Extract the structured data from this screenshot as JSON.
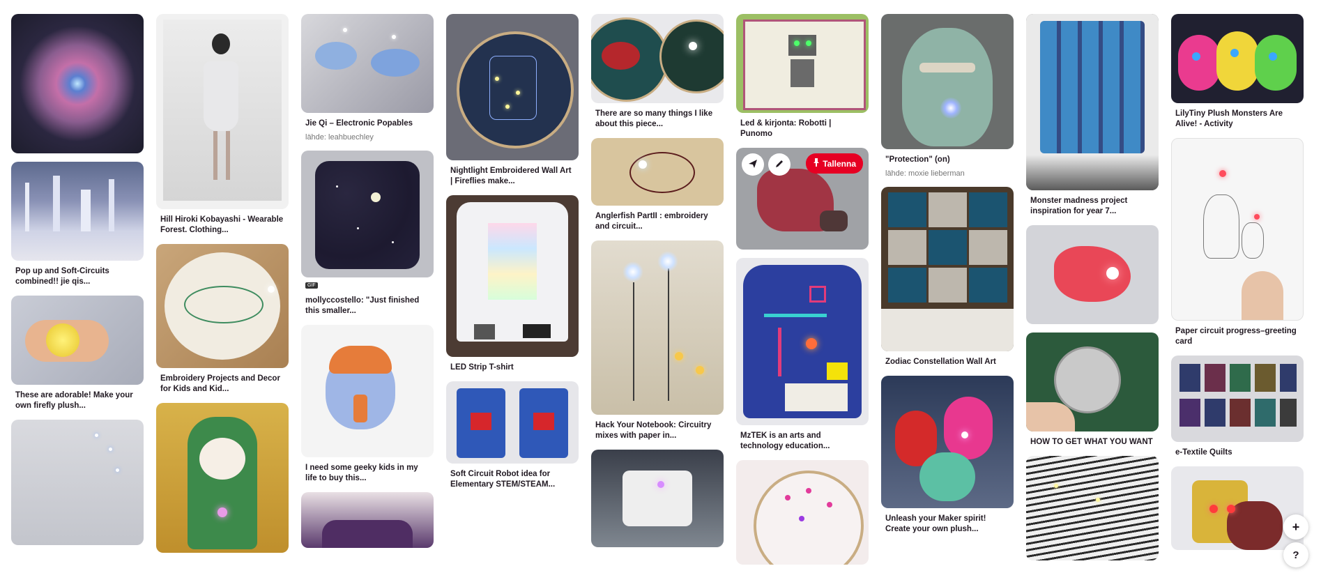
{
  "pins": {
    "c1": [
      {
        "caption": ""
      },
      {
        "caption": "Pop up and Soft-Circuits combined!! jie qis..."
      },
      {
        "caption": "These are adorable! Make your own firefly plush..."
      },
      {
        "caption": ""
      }
    ],
    "c2": [
      {
        "caption": "Hill Hiroki Kobayashi - Wearable Forest. Clothing..."
      },
      {
        "caption": "Embroidery Projects and Decor for Kids and Kid..."
      },
      {
        "caption": ""
      }
    ],
    "c3": [
      {
        "caption": "Jie Qi – Electronic Popables",
        "source": "lähde: leahbuechley"
      },
      {
        "caption": "mollyccostello: \"Just finished this smaller...",
        "badge": "GIF"
      },
      {
        "caption": "I need some geeky kids in my life to buy this..."
      },
      {
        "caption": ""
      }
    ],
    "c4": [
      {
        "caption": "Nightlight Embroidered Wall Art | Fireflies make..."
      },
      {
        "caption": "LED Strip T-shirt"
      },
      {
        "caption": "Soft Circuit Robot idea for Elementary STEM/STEAM..."
      }
    ],
    "c5": [
      {
        "caption": "There are so many things I like about this piece..."
      },
      {
        "caption": "Anglerfish PartII : embroidery and circuit..."
      },
      {
        "caption": "Hack Your Notebook: Circuitry mixes with paper in..."
      },
      {
        "caption": ""
      }
    ],
    "c6": [
      {
        "caption": "Led & kirjonta: Robotti | Punomo"
      },
      {
        "caption": "",
        "save_label": "Tallenna"
      },
      {
        "caption": "MzTEK is an arts and technology education..."
      },
      {
        "caption": ""
      }
    ],
    "c7": [
      {
        "caption": "\"Protection\" (on)",
        "source": "lähde: moxie lieberman"
      },
      {
        "caption": "Zodiac Constellation Wall Art"
      },
      {
        "caption": "Unleash your Maker spirit! Create your own plush..."
      }
    ],
    "c8": [
      {
        "caption": "Monster madness project inspiration for year 7..."
      },
      {
        "caption": ""
      },
      {
        "caption": "HOW TO GET WHAT YOU WANT"
      },
      {
        "caption": ""
      }
    ],
    "c9": [
      {
        "caption": "LilyTiny Plush Monsters Are Alive! - Activity"
      },
      {
        "caption": "Paper circuit progress–greeting card"
      },
      {
        "caption": "e-Textile Quilts"
      },
      {
        "caption": ""
      }
    ]
  },
  "fab": {
    "add": "+",
    "help": "?"
  },
  "colors": {
    "save_red": "#e60023",
    "text": "#211922",
    "muted": "#767676"
  },
  "icons": {
    "share": "share-icon",
    "edit": "pencil-icon",
    "pin": "pin-icon",
    "plus": "plus-icon",
    "help": "help-icon"
  }
}
